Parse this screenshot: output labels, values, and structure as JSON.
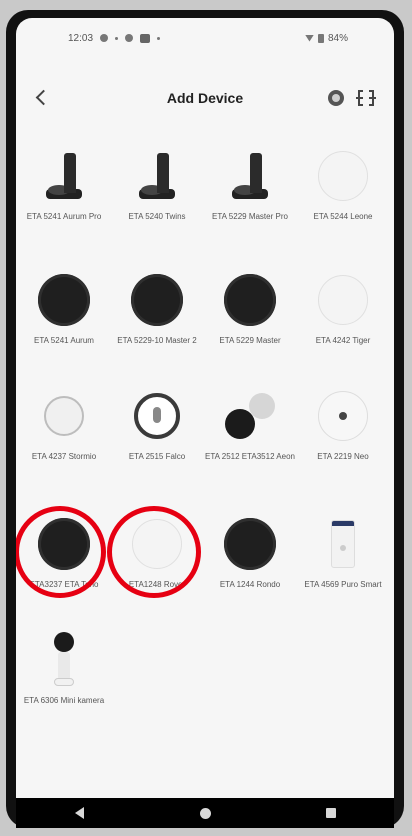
{
  "status_bar": {
    "time": "12:03",
    "battery": "84%"
  },
  "header": {
    "title": "Add Device"
  },
  "devices": [
    {
      "label": "ETA 5241 Aurum Pro",
      "icon": "base-station"
    },
    {
      "label": "ETA 5240 Twins",
      "icon": "base-station"
    },
    {
      "label": "ETA 5229 Master Pro",
      "icon": "base-station"
    },
    {
      "label": "ETA 5244 Leone",
      "icon": "white-robot"
    },
    {
      "label": "ETA 5241 Aurum",
      "icon": "black-robot"
    },
    {
      "label": "ETA 5229-10 Master 2",
      "icon": "black-robot"
    },
    {
      "label": "ETA 5229 Master",
      "icon": "black-robot"
    },
    {
      "label": "ETA 4242 Tiger",
      "icon": "white-robot"
    },
    {
      "label": "ETA 4237 Stormio",
      "icon": "stick-robot"
    },
    {
      "label": "ETA 2515 Falco",
      "icon": "falco-robot"
    },
    {
      "label": "ETA 2512 ETA3512 Aeon",
      "icon": "robot-pair"
    },
    {
      "label": "ETA 2219 Neo",
      "icon": "white-lidar-robot"
    },
    {
      "label": "ETA3237 ETA Tono",
      "icon": "black-robot",
      "highlighted": true
    },
    {
      "label": "ETA1248 Rover",
      "icon": "white-robot",
      "highlighted": true
    },
    {
      "label": "ETA 1244 Rondo",
      "icon": "black-robot"
    },
    {
      "label": "ETA 4569 Puro Smart",
      "icon": "air-purifier"
    },
    {
      "label": "ETA 6306 Mini kamera",
      "icon": "camera"
    }
  ],
  "highlight_color": "#e60012"
}
